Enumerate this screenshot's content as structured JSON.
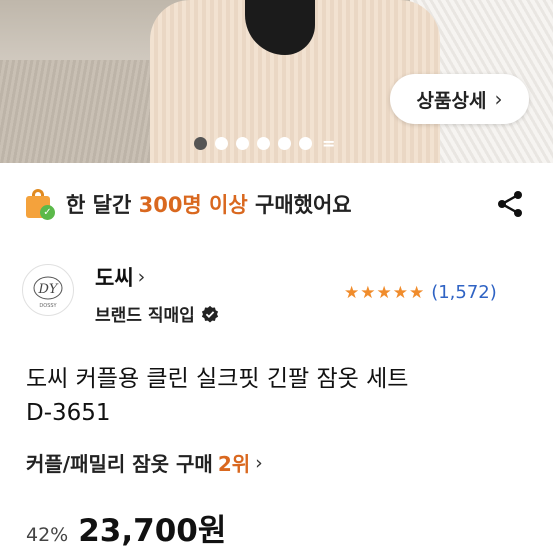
{
  "hero": {
    "detail_button": "상품상세",
    "detail_chevron": "›",
    "carousel": {
      "total_dots": 6,
      "active_index": 0,
      "more_marker": "="
    }
  },
  "banner": {
    "icon": "shopping-bag-check-icon",
    "prefix": "한 달간 ",
    "highlight": "300명 이상",
    "suffix": " 구매했어요",
    "share_icon": "share-icon",
    "highlight_color": "#d9681f"
  },
  "brand": {
    "logo_icon": "dossy-brand-logo",
    "name": "도씨",
    "chevron": "›",
    "subtitle": "브랜드 직매입",
    "verified_icon": "verified-badge-icon"
  },
  "rating": {
    "stars": 5,
    "star_glyphs": "★★★★★",
    "review_count": "(1,572)",
    "star_color": "#f08c2c",
    "count_color": "#2f63c4"
  },
  "product": {
    "title_line1": "도씨 커플용 클린 실크핏 긴팔 잠옷 세트",
    "title_line2": "D-3651"
  },
  "ranking": {
    "label": "커플/패밀리 잠옷 구매",
    "position": "2위",
    "chevron": "›"
  },
  "price": {
    "discount": "42%",
    "amount": "23,700원"
  }
}
